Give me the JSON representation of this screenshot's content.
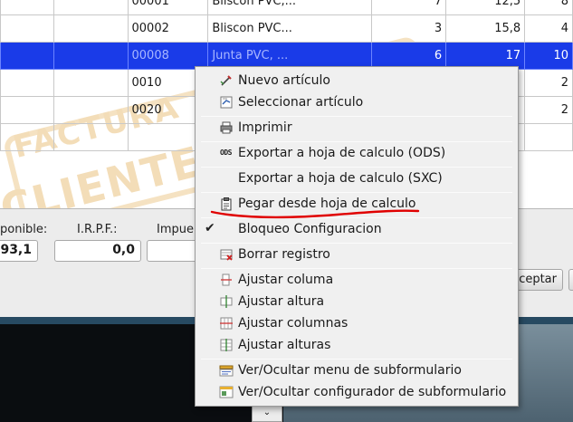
{
  "table": {
    "rows": [
      {
        "code": "00001",
        "description": "Bliscon PVC,...",
        "qty": "7",
        "price": "12,5",
        "extra": "8"
      },
      {
        "code": "00002",
        "description": "Bliscon PVC...",
        "qty": "3",
        "price": "15,8",
        "extra": "4"
      },
      {
        "code": "00008",
        "description": "Junta PVC, ...",
        "qty": "6",
        "price": "17",
        "extra": "10"
      },
      {
        "code": "0010",
        "description": "",
        "qty": "",
        "price": "",
        "extra": "2"
      },
      {
        "code": "0020",
        "description": "",
        "qty": "",
        "price": "",
        "extra": "2"
      }
    ],
    "watermark": {
      "line1": "FACTURA",
      "line2": "CLIENTE"
    }
  },
  "form": {
    "disponible_label": "ponible:",
    "disponible_value": "93,1",
    "irpf_label": "I.R.P.F.:",
    "irpf_value": "0,0",
    "impuestos_label": "Impue",
    "accept_button": "ceptar"
  },
  "context_menu": {
    "items": [
      {
        "label": "Nuevo artículo",
        "icon": "new-article-icon"
      },
      {
        "label": "Seleccionar artículo",
        "icon": "select-article-icon"
      },
      {
        "label": "Imprimir",
        "icon": "print-icon"
      },
      {
        "label": "Exportar a hoja de calculo (ODS)",
        "icon": "ods-icon",
        "icon_text": "ODS"
      },
      {
        "label": "Exportar a hoja de calculo (SXC)",
        "icon": ""
      },
      {
        "label": "Pegar desde hoja de calculo",
        "icon": "clipboard-icon"
      },
      {
        "label": "Bloqueo Configuracion",
        "icon": "check-icon",
        "check": "✔"
      },
      {
        "label": "Borrar registro",
        "icon": "delete-record-icon"
      },
      {
        "label": "Ajustar columa",
        "icon": "adjust-column-icon"
      },
      {
        "label": "Ajustar altura",
        "icon": "adjust-height-icon"
      },
      {
        "label": "Ajustar columnas",
        "icon": "adjust-columns-icon"
      },
      {
        "label": "Ajustar alturas",
        "icon": "adjust-heights-icon"
      },
      {
        "label": "Ver/Ocultar menu de subformulario",
        "icon": "submenu-icon"
      },
      {
        "label": "Ver/Ocultar configurador de subformulario",
        "icon": "subconfig-icon"
      }
    ]
  },
  "colors": {
    "selection": "#1a3be8",
    "annotation": "#e00000"
  }
}
